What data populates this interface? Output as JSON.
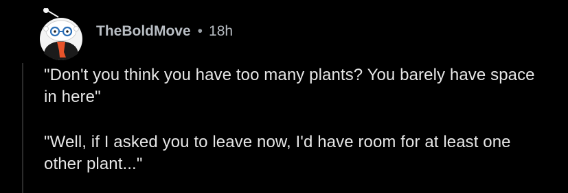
{
  "comment": {
    "author": "TheBoldMove",
    "separator": "•",
    "age": "18h",
    "avatar_icon": "snoo-avatar-icon",
    "paragraphs": [
      "\"Don't you think you have too many plants? You barely have space in here\"",
      "\"Well, if I asked you to leave now, I'd have room for at least one other plant...\""
    ]
  },
  "colors": {
    "background": "#000000",
    "text": "#e6e6e6",
    "meta_text": "#b9bec4",
    "thread_line": "#2b2b2b",
    "avatar_bg": "#f4f4f4",
    "scarf": "#e8532a"
  }
}
